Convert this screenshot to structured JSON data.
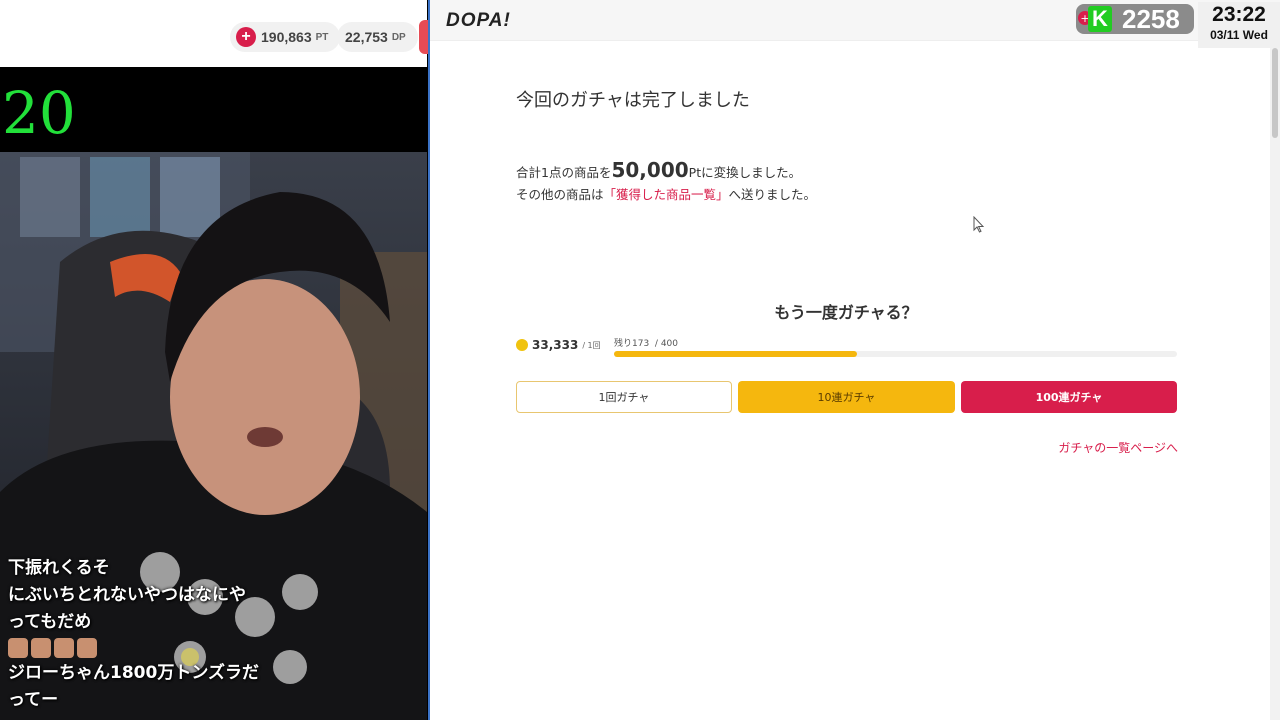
{
  "left_bar": {
    "points": "190,863",
    "points_unit": "PT",
    "dp": "22,753",
    "dp_unit": "DP"
  },
  "counter": "20",
  "chat_lines": [
    "下振れくるそ",
    "にぶいちとれないやつはなにや",
    "ってもだめ",
    "ジローちゃん1800万トンズラだ",
    "ってー"
  ],
  "site": {
    "logo": "DOPA!",
    "title": "今回のガチャは完了しました",
    "msg1_prefix": "合計1点の商品を",
    "msg1_amount": "50,000",
    "msg1_suffix_unit": "Pt",
    "msg1_suffix": "に変換しました。",
    "msg2_prefix": "その他の商品は",
    "msg2_link": "「獲得した商品一覧」",
    "msg2_suffix": "へ送りました。",
    "again": "もう一度ガチャる？",
    "coin_amount": "33,333",
    "coin_per": "/ 1回",
    "remain_label": "残り173",
    "remain_total": "/ 400",
    "remaining_fraction": 0.4325,
    "btn_1": "1回ガチャ",
    "btn_10": "10連ガチャ",
    "btn_100": "100連ガチャ",
    "list_link": "ガチャの一覧ページへ"
  },
  "overlay": {
    "k_letter": "K",
    "k_value": "2258",
    "time": "23:22",
    "date": "03/11 Wed"
  },
  "colors": {
    "accent_red": "#d81e4b",
    "accent_yellow": "#f5b70e",
    "counter_green": "#22e03a"
  }
}
